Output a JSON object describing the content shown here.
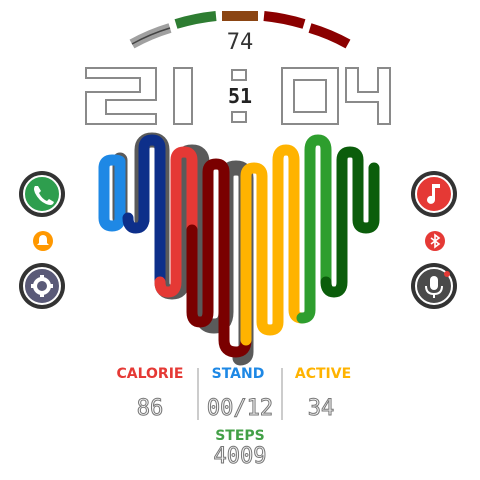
{
  "battery": {
    "value": "74",
    "segment_colors": [
      "#a0a0a0",
      "#2e7d32",
      "#8b4513",
      "#8b0000",
      "#8b0000"
    ]
  },
  "time": {
    "hours": "21",
    "minutes": "04",
    "seconds": "51"
  },
  "stats": {
    "calorie_label": "CALORIE",
    "stand_label": "STAND",
    "active_label": "ACTIVE",
    "calorie_value": "86",
    "stand_value": "00/12",
    "active_value": "34",
    "steps_label": "STEPS",
    "steps_value": "4009"
  },
  "colors": {
    "calorie": "#e53935",
    "stand": "#1e88e5",
    "active": "#ffb300",
    "steps": "#43a047",
    "wave": [
      "#1e88e5",
      "#0d2f8a",
      "#e53935",
      "#7a0000",
      "#ffb300",
      "#2e9e2e",
      "#0b5d0b"
    ]
  },
  "buttons": {
    "left_top": "phone-icon",
    "left_mid": "bell-icon",
    "left_bottom": "gear-icon",
    "right_top": "music-note-icon",
    "right_mid": "bluetooth-icon",
    "right_bottom": "microphone-icon"
  }
}
